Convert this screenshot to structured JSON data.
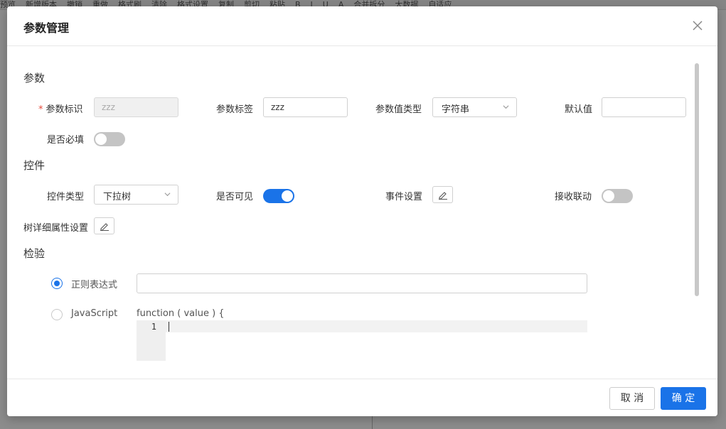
{
  "background_toolbar": [
    "预览",
    "新增版本",
    "撤销",
    "重做",
    "格式刷",
    "清除",
    "格式设置",
    "复制",
    "剪切",
    "粘贴",
    "B",
    "I",
    "U",
    "A",
    "合并拆分",
    "大数据",
    "自适应"
  ],
  "dialog": {
    "title": "参数管理",
    "close_icon": "close-icon"
  },
  "sections": {
    "params": "参数",
    "control": "控件",
    "validation": "检验"
  },
  "params": {
    "id_label": "参数标识",
    "id_required_mark": "*",
    "id_value": "zzz",
    "tag_label": "参数标签",
    "tag_value": "zzz",
    "value_type_label": "参数值类型",
    "value_type_selected": "字符串",
    "default_label": "默认值",
    "default_value": "",
    "required_label": "是否必填",
    "required_on": false
  },
  "control": {
    "type_label": "控件类型",
    "type_selected": "下拉树",
    "visible_label": "是否可见",
    "visible_on": true,
    "event_label": "事件设置",
    "linkage_label": "接收联动",
    "linkage_on": false,
    "tree_label": "树详细属性设置"
  },
  "validation": {
    "regex_label": "正则表达式",
    "regex_selected": true,
    "regex_value": "",
    "js_label": "JavaScript",
    "js_selected": false,
    "fn_signature": "function ( value ) {",
    "line_number": "1"
  },
  "footer": {
    "cancel_label": "取 消",
    "ok_label": "确 定"
  },
  "colors": {
    "primary": "#1a73e8",
    "required": "#e64b3c",
    "toggle_off": "#c4c4c4"
  }
}
